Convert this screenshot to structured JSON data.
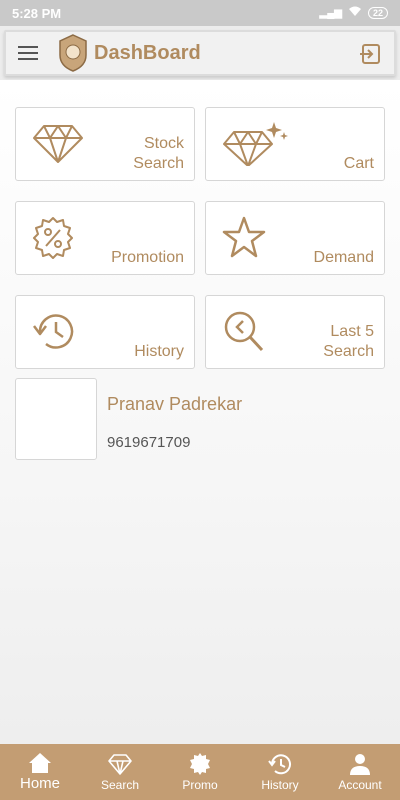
{
  "status_bar": {
    "time": "5:28 PM",
    "battery": "22"
  },
  "app_bar": {
    "title": "DashBoard"
  },
  "tiles": [
    {
      "label": "Stock\nSearch",
      "icon": "diamond-icon"
    },
    {
      "label": "Cart",
      "icon": "sparkle-diamond-icon"
    },
    {
      "label": "Promotion",
      "icon": "percent-badge-icon"
    },
    {
      "label": "Demand",
      "icon": "star-icon"
    },
    {
      "label": "History",
      "icon": "history-icon"
    },
    {
      "label": "Last 5\nSearch",
      "icon": "search-back-icon"
    }
  ],
  "profile": {
    "name": "Pranav Padrekar",
    "phone": "9619671709"
  },
  "bottom_nav": [
    {
      "label": "Home",
      "icon": "home-icon",
      "active": true
    },
    {
      "label": "Search",
      "icon": "diamond-icon"
    },
    {
      "label": "Promo",
      "icon": "badge-icon"
    },
    {
      "label": "History",
      "icon": "history-icon"
    },
    {
      "label": "Account",
      "icon": "person-icon"
    }
  ],
  "colors": {
    "accent": "#b08b5f",
    "nav_bg": "#c39d73",
    "status_bar": "#c9c9c9"
  }
}
